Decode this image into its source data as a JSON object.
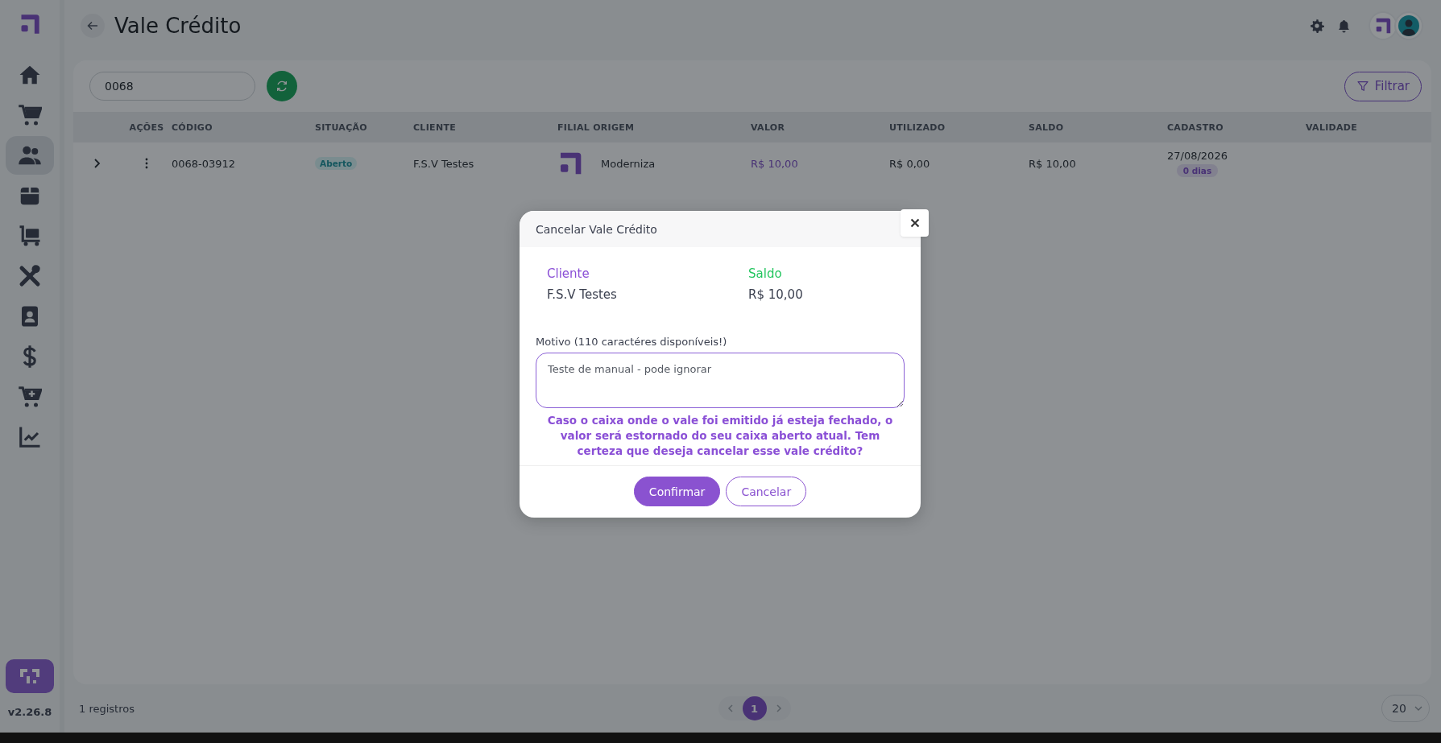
{
  "sidebar": {
    "items": [
      {
        "selected": false
      },
      {
        "selected": false
      },
      {
        "selected": true
      },
      {
        "selected": false
      },
      {
        "selected": false
      },
      {
        "selected": false
      },
      {
        "selected": false
      },
      {
        "selected": false
      },
      {
        "selected": false
      },
      {
        "selected": false
      }
    ],
    "version": "v2.26.8"
  },
  "header": {
    "title": "Vale Crédito"
  },
  "toolbar": {
    "search": {
      "value": "0068"
    },
    "filter_button": "Filtrar"
  },
  "table": {
    "columns": [
      "",
      "AÇÕES",
      "CÓDIGO",
      "SITUAÇÃO",
      "CLIENTE",
      "FILIAL ORIGEM",
      "VALOR",
      "UTILIZADO",
      "SALDO",
      "CADASTRO",
      "VALIDADE"
    ],
    "rows": [
      {
        "expanded": false,
        "codigo": "0068-03912",
        "situacao": "Aberto",
        "cliente": "F.S.V Testes",
        "filial_origem": "Moderniza",
        "valor": "R$ 10,00",
        "utilizado": "R$ 0,00",
        "saldo": "R$ 10,00",
        "cadastro": "27/08/2026",
        "cadastro_badge": "0 dias"
      }
    ]
  },
  "footer": {
    "count": "1 registros",
    "pages": [
      {
        "label": "1",
        "selected": true
      }
    ],
    "page_size": "20"
  },
  "dialog": {
    "title": "Cancelar Vale Crédito",
    "fields": [
      {
        "label": "Cliente",
        "value": "F.S.V Testes",
        "color": "#8a4fd6"
      },
      {
        "label": "Saldo",
        "value": "R$ 10,00",
        "color": "#22c55e"
      }
    ],
    "reason_label": "Motivo (110 caractéres disponíveis!)",
    "reason_value": "Teste de manual - pode ignorar",
    "warning": "Caso o caixa onde o vale foi emitido já esteja fechado, o valor será estornado do seu caixa aberto atual. Tem certeza que deseja cancelar esse vale crédito?",
    "buttons": [
      {
        "label": "Confirmar",
        "kind": "primary"
      },
      {
        "label": "Cancelar",
        "kind": "outline"
      }
    ]
  }
}
